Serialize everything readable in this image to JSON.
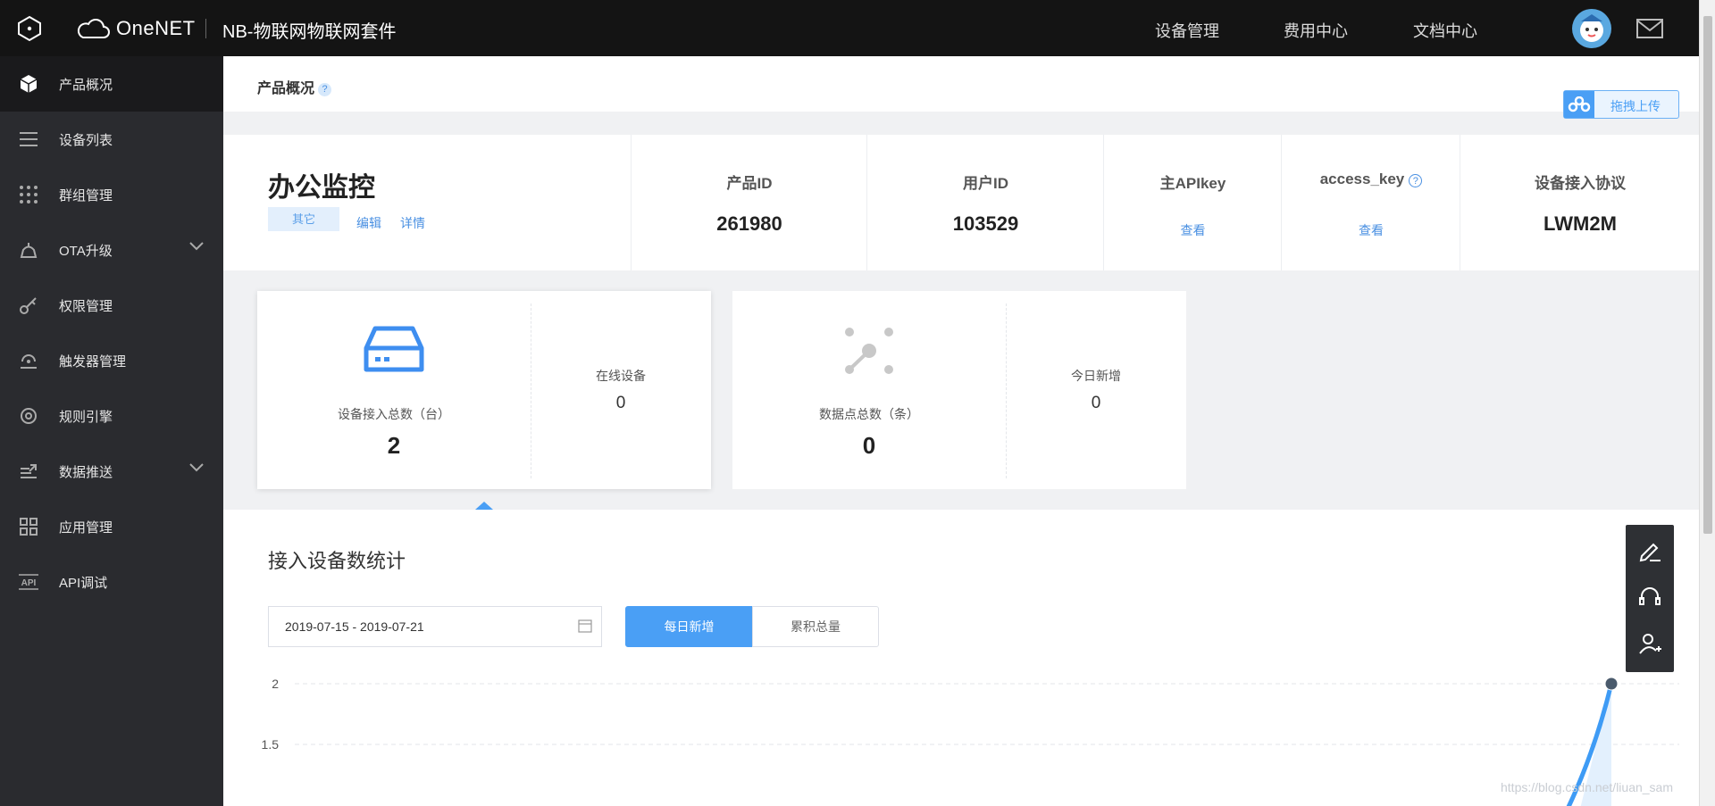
{
  "header": {
    "brand": "OneNET",
    "app_title": "NB-物联网物联网套件",
    "nav": [
      "设备管理",
      "费用中心",
      "文档中心"
    ]
  },
  "sidebar": {
    "items": [
      {
        "label": "产品概况",
        "icon": "cube-icon",
        "active": true
      },
      {
        "label": "设备列表",
        "icon": "list-icon"
      },
      {
        "label": "群组管理",
        "icon": "grid-dots-icon"
      },
      {
        "label": "OTA升级",
        "icon": "ota-icon",
        "expandable": true
      },
      {
        "label": "权限管理",
        "icon": "key-icon"
      },
      {
        "label": "触发器管理",
        "icon": "trigger-icon"
      },
      {
        "label": "规则引擎",
        "icon": "rule-engine-icon"
      },
      {
        "label": "数据推送",
        "icon": "push-icon",
        "expandable": true
      },
      {
        "label": "应用管理",
        "icon": "apps-icon"
      },
      {
        "label": "API调试",
        "icon": "api-icon"
      }
    ]
  },
  "page": {
    "breadcrumb_title": "产品概况",
    "help_mark": "?",
    "upload_label": "拖拽上传"
  },
  "product": {
    "name": "办公监控",
    "tag": "其它",
    "edit_link": "编辑",
    "detail_link": "详情",
    "fields": [
      {
        "label": "产品ID",
        "value": "261980"
      },
      {
        "label": "用户ID",
        "value": "103529"
      },
      {
        "label": "主APIkey",
        "link": "查看"
      },
      {
        "label": "access_key",
        "link": "查看",
        "help": "?"
      },
      {
        "label": "设备接入协议",
        "value": "LWM2M"
      }
    ]
  },
  "cards": [
    {
      "main_label": "设备接入总数（台）",
      "main_value": "2",
      "side_label": "在线设备",
      "side_value": "0",
      "icon": "device-box-icon"
    },
    {
      "main_label": "数据点总数（条）",
      "main_value": "0",
      "side_label": "今日新增",
      "side_value": "0",
      "icon": "datapoint-icon"
    }
  ],
  "stats": {
    "title": "接入设备数统计",
    "date_range": "2019-07-15 - 2019-07-21",
    "toggle_daily": "每日新增",
    "toggle_total": "累积总量"
  },
  "chart_data": {
    "type": "line",
    "y_ticks": [
      "2",
      "1.5"
    ],
    "ylim": [
      1.5,
      2
    ],
    "series": [
      {
        "values": [
          2
        ]
      }
    ],
    "grid": true,
    "color": "#3e9bf5"
  },
  "watermark": "https://blog.csdn.net/liuan_sam"
}
